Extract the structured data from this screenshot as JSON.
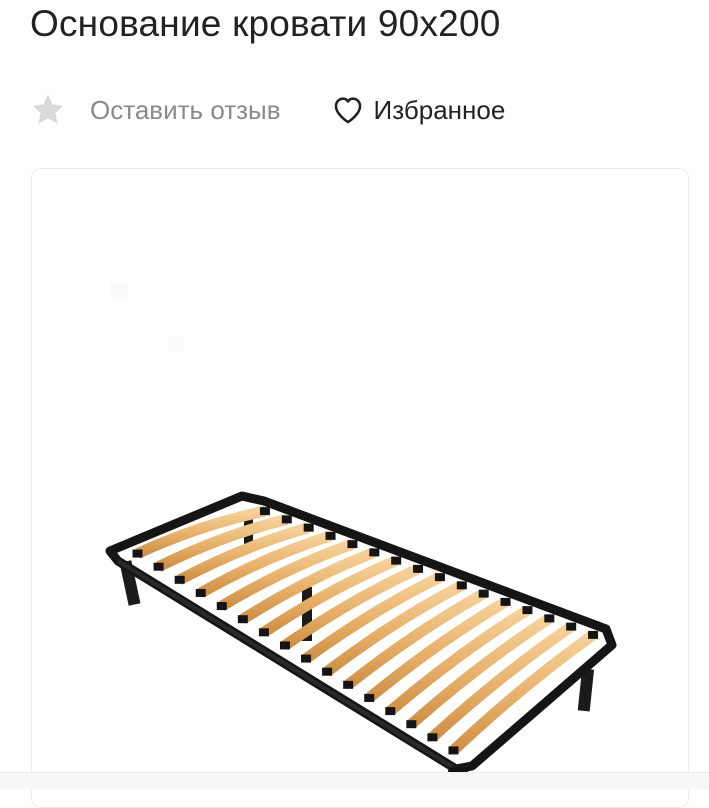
{
  "product": {
    "title": "Основание кровати 90x200"
  },
  "actions": {
    "review_label": "Оставить отзыв",
    "favorite_label": "Избранное"
  },
  "icons": {
    "review": "star-icon",
    "favorite": "heart-icon"
  },
  "colors": {
    "title": "#222222",
    "review_text": "#8a8a8a",
    "star": "#d9d9d9",
    "heart_outline": "#222222",
    "card_border": "#ececec",
    "slat": "#e8b36a",
    "frame": "#1a1a1a"
  }
}
